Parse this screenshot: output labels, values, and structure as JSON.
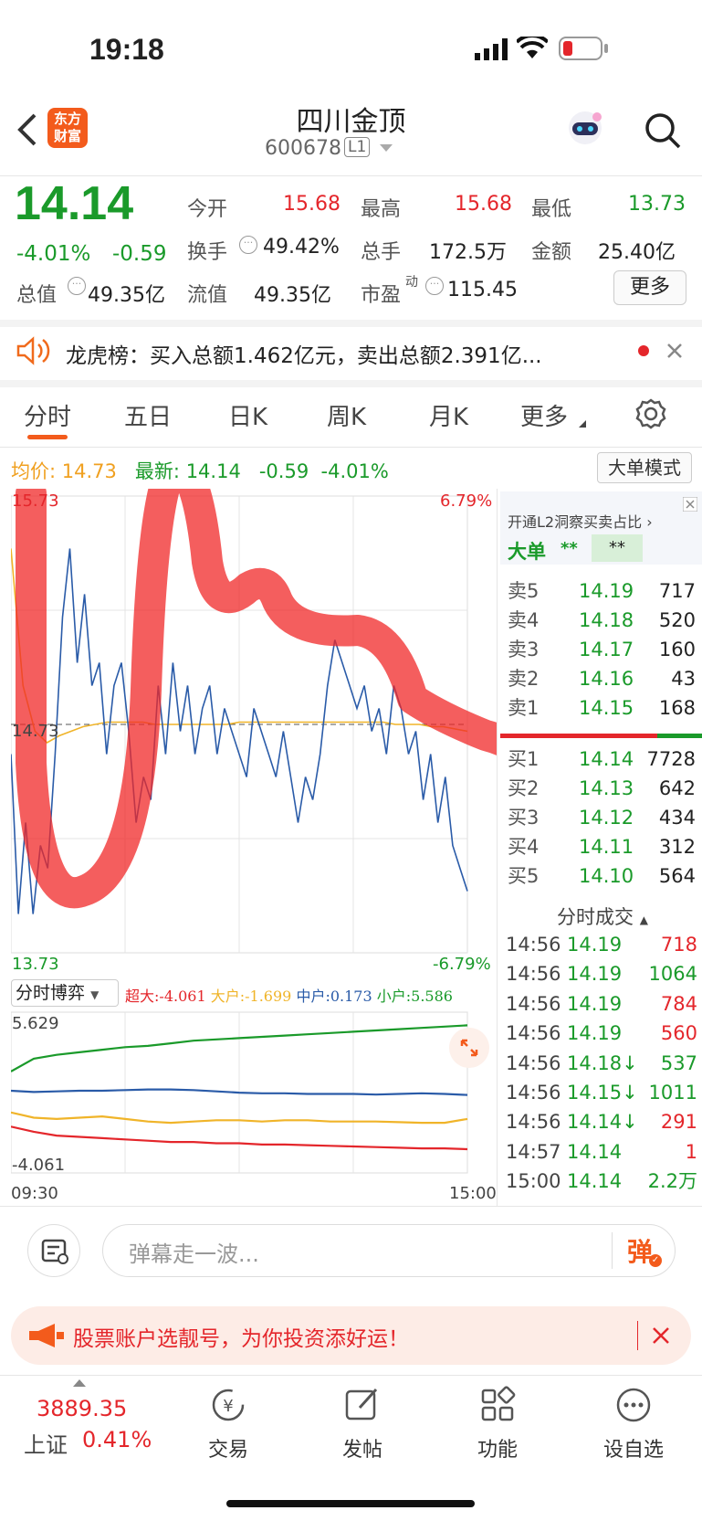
{
  "status": {
    "time": "19:18"
  },
  "header": {
    "title": "四川金顶",
    "code": "600678",
    "level": "L1",
    "logo_text": [
      "东方",
      "财富"
    ]
  },
  "quote": {
    "price": "14.14",
    "change_pct": "-4.01%",
    "change": "-0.59",
    "open_label": "今开",
    "open": "15.68",
    "high_label": "最高",
    "high": "15.68",
    "low_label": "最低",
    "low": "13.73",
    "turnover_label": "换手",
    "turnover": "49.42%",
    "volume_label": "总手",
    "volume": "172.5万",
    "amount_label": "金额",
    "amount": "25.40亿",
    "mcap_label": "总值",
    "mcap": "49.35亿",
    "float_label": "流值",
    "float": "49.35亿",
    "pe_label": "市盈",
    "pe_sup": "动",
    "pe": "115.45",
    "more_button": "更多"
  },
  "notice": {
    "text": "龙虎榜：买入总额1.462亿元，卖出总额2.391亿..."
  },
  "tabs": [
    {
      "label": "分时"
    },
    {
      "label": "五日"
    },
    {
      "label": "日K"
    },
    {
      "label": "周K"
    },
    {
      "label": "月K"
    },
    {
      "label": "更多"
    }
  ],
  "chart_info": {
    "avg_label": "均价:",
    "avg": "14.73",
    "latest_label": "最新:",
    "latest": "14.14",
    "chg": "-0.59",
    "pct": "-4.01%",
    "mode_button": "大单模式"
  },
  "chart_data": [
    {
      "type": "line",
      "y_top_label": "15.73",
      "y_bottom_label": "13.73",
      "y_mid_label": "14.73",
      "pct_top": "6.79%",
      "pct_bottom": "-6.79%",
      "ylim": [
        13.73,
        15.73
      ],
      "series": [
        {
          "values": [
            14.6,
            13.9,
            14.3,
            13.9,
            14.2,
            14.1,
            14.6,
            15.2,
            15.5,
            15.0,
            15.3,
            14.9,
            15.0,
            14.6,
            14.9,
            15.0,
            14.7,
            14.3,
            14.5,
            14.4,
            14.9,
            14.6,
            15.0,
            14.7,
            14.9,
            14.6,
            14.8,
            14.9,
            14.6,
            14.8,
            14.7,
            14.6,
            14.5,
            14.8,
            14.7,
            14.6,
            14.5,
            14.7,
            14.5,
            14.3,
            14.5,
            14.4,
            14.6,
            14.9,
            15.1,
            15.0,
            14.9,
            14.8,
            14.9,
            14.7,
            14.8,
            14.6,
            14.9,
            14.8,
            14.6,
            14.7,
            14.4,
            14.6,
            14.3,
            14.5,
            14.2,
            14.1,
            14.0
          ]
        },
        {
          "values": [
            15.5,
            14.9,
            14.7,
            14.65,
            14.68,
            14.7,
            14.72,
            14.73,
            14.74,
            14.74,
            14.74,
            14.74,
            14.73,
            14.73,
            14.73,
            14.73,
            14.73,
            14.73,
            14.73,
            14.74,
            14.74,
            14.74,
            14.74,
            14.74,
            14.74,
            14.74,
            14.74,
            14.74,
            14.74,
            14.74,
            14.74,
            14.74,
            14.73,
            14.73,
            14.73,
            14.72,
            14.72,
            14.71,
            14.7
          ]
        }
      ]
    },
    {
      "type": "line",
      "title": "分时博弈",
      "legend": [
        {
          "name": "超大",
          "value": "-4.061",
          "color": "#e4262b"
        },
        {
          "name": "大户",
          "value": "-1.699",
          "color": "#f0b429"
        },
        {
          "name": "中户",
          "value": "0.173",
          "color": "#2a5ba8"
        },
        {
          "name": "小户",
          "value": "5.586",
          "color": "#1a9a2a"
        }
      ],
      "y_top_label": "5.629",
      "y_bottom_label": "-4.061",
      "x_labels": [
        "09:30",
        "15:00"
      ],
      "ylim": [
        -4.061,
        5.629
      ],
      "series": [
        {
          "name": "小户",
          "values": [
            2.0,
            3.0,
            3.3,
            3.5,
            3.7,
            3.9,
            4.0,
            4.2,
            4.4,
            4.5,
            4.6,
            4.7,
            4.8,
            4.9,
            5.0,
            5.1,
            5.2,
            5.3,
            5.4,
            5.5,
            5.6
          ]
        },
        {
          "name": "中户",
          "values": [
            0.5,
            0.4,
            0.45,
            0.5,
            0.5,
            0.55,
            0.6,
            0.6,
            0.55,
            0.45,
            0.35,
            0.3,
            0.3,
            0.25,
            0.25,
            0.25,
            0.2,
            0.25,
            0.3,
            0.25,
            0.17
          ]
        },
        {
          "name": "大户",
          "values": [
            -1.2,
            -1.6,
            -1.7,
            -1.6,
            -1.5,
            -1.7,
            -1.9,
            -2.0,
            -1.9,
            -1.8,
            -1.8,
            -1.9,
            -1.8,
            -1.8,
            -1.9,
            -1.9,
            -1.9,
            -1.95,
            -2.0,
            -2.0,
            -1.7
          ]
        },
        {
          "name": "超大",
          "values": [
            -2.3,
            -2.7,
            -3.0,
            -3.1,
            -3.2,
            -3.3,
            -3.4,
            -3.5,
            -3.5,
            -3.6,
            -3.6,
            -3.7,
            -3.7,
            -3.75,
            -3.8,
            -3.85,
            -3.9,
            -3.95,
            -4.0,
            -4.0,
            -4.06
          ]
        }
      ]
    }
  ],
  "orderbook": {
    "promo": "开通L2洞察买卖占比",
    "big_order": "大单",
    "stars1": "**",
    "stars2": "**",
    "asks": [
      {
        "label": "卖5",
        "price": "14.19",
        "vol": "717"
      },
      {
        "label": "卖4",
        "price": "14.18",
        "vol": "520"
      },
      {
        "label": "卖3",
        "price": "14.17",
        "vol": "160"
      },
      {
        "label": "卖2",
        "price": "14.16",
        "vol": "43"
      },
      {
        "label": "卖1",
        "price": "14.15",
        "vol": "168"
      }
    ],
    "bids": [
      {
        "label": "买1",
        "price": "14.14",
        "vol": "7728"
      },
      {
        "label": "买2",
        "price": "14.13",
        "vol": "642"
      },
      {
        "label": "买3",
        "price": "14.12",
        "vol": "434"
      },
      {
        "label": "买4",
        "price": "14.11",
        "vol": "312"
      },
      {
        "label": "买5",
        "price": "14.10",
        "vol": "564"
      }
    ],
    "trades_title": "分时成交",
    "trades": [
      {
        "time": "14:56",
        "price": "14.19",
        "vol": "718",
        "c": "red"
      },
      {
        "time": "14:56",
        "price": "14.19",
        "vol": "1064",
        "c": "green"
      },
      {
        "time": "14:56",
        "price": "14.19",
        "vol": "784",
        "c": "red"
      },
      {
        "time": "14:56",
        "price": "14.19",
        "vol": "560",
        "c": "red"
      },
      {
        "time": "14:56",
        "price": "14.18↓",
        "vol": "537",
        "c": "green"
      },
      {
        "time": "14:56",
        "price": "14.15↓",
        "vol": "1011",
        "c": "green"
      },
      {
        "time": "14:56",
        "price": "14.14↓",
        "vol": "291",
        "c": "red"
      },
      {
        "time": "14:57",
        "price": "14.14",
        "vol": "1",
        "c": "red"
      },
      {
        "time": "15:00",
        "price": "14.14",
        "vol": "2.2万",
        "c": "green"
      }
    ]
  },
  "comment": {
    "placeholder": "弹幕走一波...",
    "send": "弹"
  },
  "promo_banner": {
    "text": "股票账户选靓号，为你投资添好运！"
  },
  "bottom": {
    "index_value": "3889.35",
    "index_name": "上证",
    "index_pct": "0.41%",
    "tabs": [
      {
        "label": "交易"
      },
      {
        "label": "发帖"
      },
      {
        "label": "功能"
      },
      {
        "label": "设自选"
      }
    ]
  }
}
